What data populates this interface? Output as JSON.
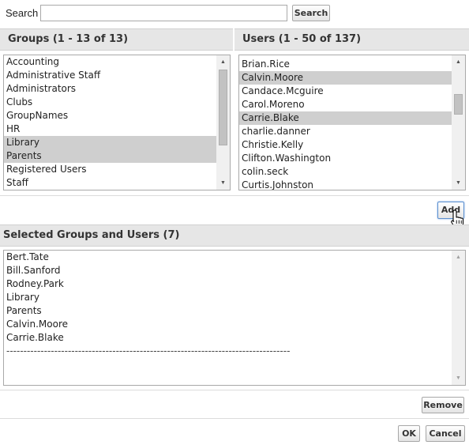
{
  "search": {
    "label": "Search",
    "value": "",
    "placeholder": "",
    "button_label": "Search"
  },
  "groups": {
    "header": "Groups (1 - 13 of 13)",
    "items": [
      {
        "label": "Accounting",
        "selected": false
      },
      {
        "label": "Administrative Staff",
        "selected": false
      },
      {
        "label": "Administrators",
        "selected": false
      },
      {
        "label": "Clubs",
        "selected": false
      },
      {
        "label": "GroupNames",
        "selected": false
      },
      {
        "label": "HR",
        "selected": false
      },
      {
        "label": "Library",
        "selected": true
      },
      {
        "label": "Parents",
        "selected": true
      },
      {
        "label": "Registered Users",
        "selected": false
      },
      {
        "label": "Staff",
        "selected": false
      }
    ]
  },
  "users": {
    "header": "Users (1 - 50 of 137)",
    "items": [
      {
        "label": "Brian.Rice",
        "selected": false
      },
      {
        "label": "Calvin.Moore",
        "selected": true
      },
      {
        "label": "Candace.Mcguire",
        "selected": false
      },
      {
        "label": "Carol.Moreno",
        "selected": false
      },
      {
        "label": "Carrie.Blake",
        "selected": true
      },
      {
        "label": "charlie.danner",
        "selected": false
      },
      {
        "label": "Christie.Kelly",
        "selected": false
      },
      {
        "label": "Clifton.Washington",
        "selected": false
      },
      {
        "label": "colin.seck",
        "selected": false
      },
      {
        "label": "Curtis.Johnston",
        "selected": false
      }
    ]
  },
  "add_button_label": "Add",
  "selected": {
    "header": "Selected Groups and Users (7)",
    "items": [
      "Bert.Tate",
      "Bill.Sanford",
      "Rodney.Park",
      "Library",
      "Parents",
      "Calvin.Moore",
      "Carrie.Blake"
    ],
    "separator": "-----------------------------------------------------------------------------------"
  },
  "remove_button_label": "Remove",
  "ok_button_label": "OK",
  "cancel_button_label": "Cancel",
  "scroll_positions": {
    "groups": 0.0,
    "users": 0.2,
    "selected": 0.0
  },
  "icons": {
    "scroll_up": "scroll-up-arrow-icon",
    "scroll_down": "scroll-down-arrow-icon",
    "cursor": "hand-pointer-cursor-icon"
  }
}
